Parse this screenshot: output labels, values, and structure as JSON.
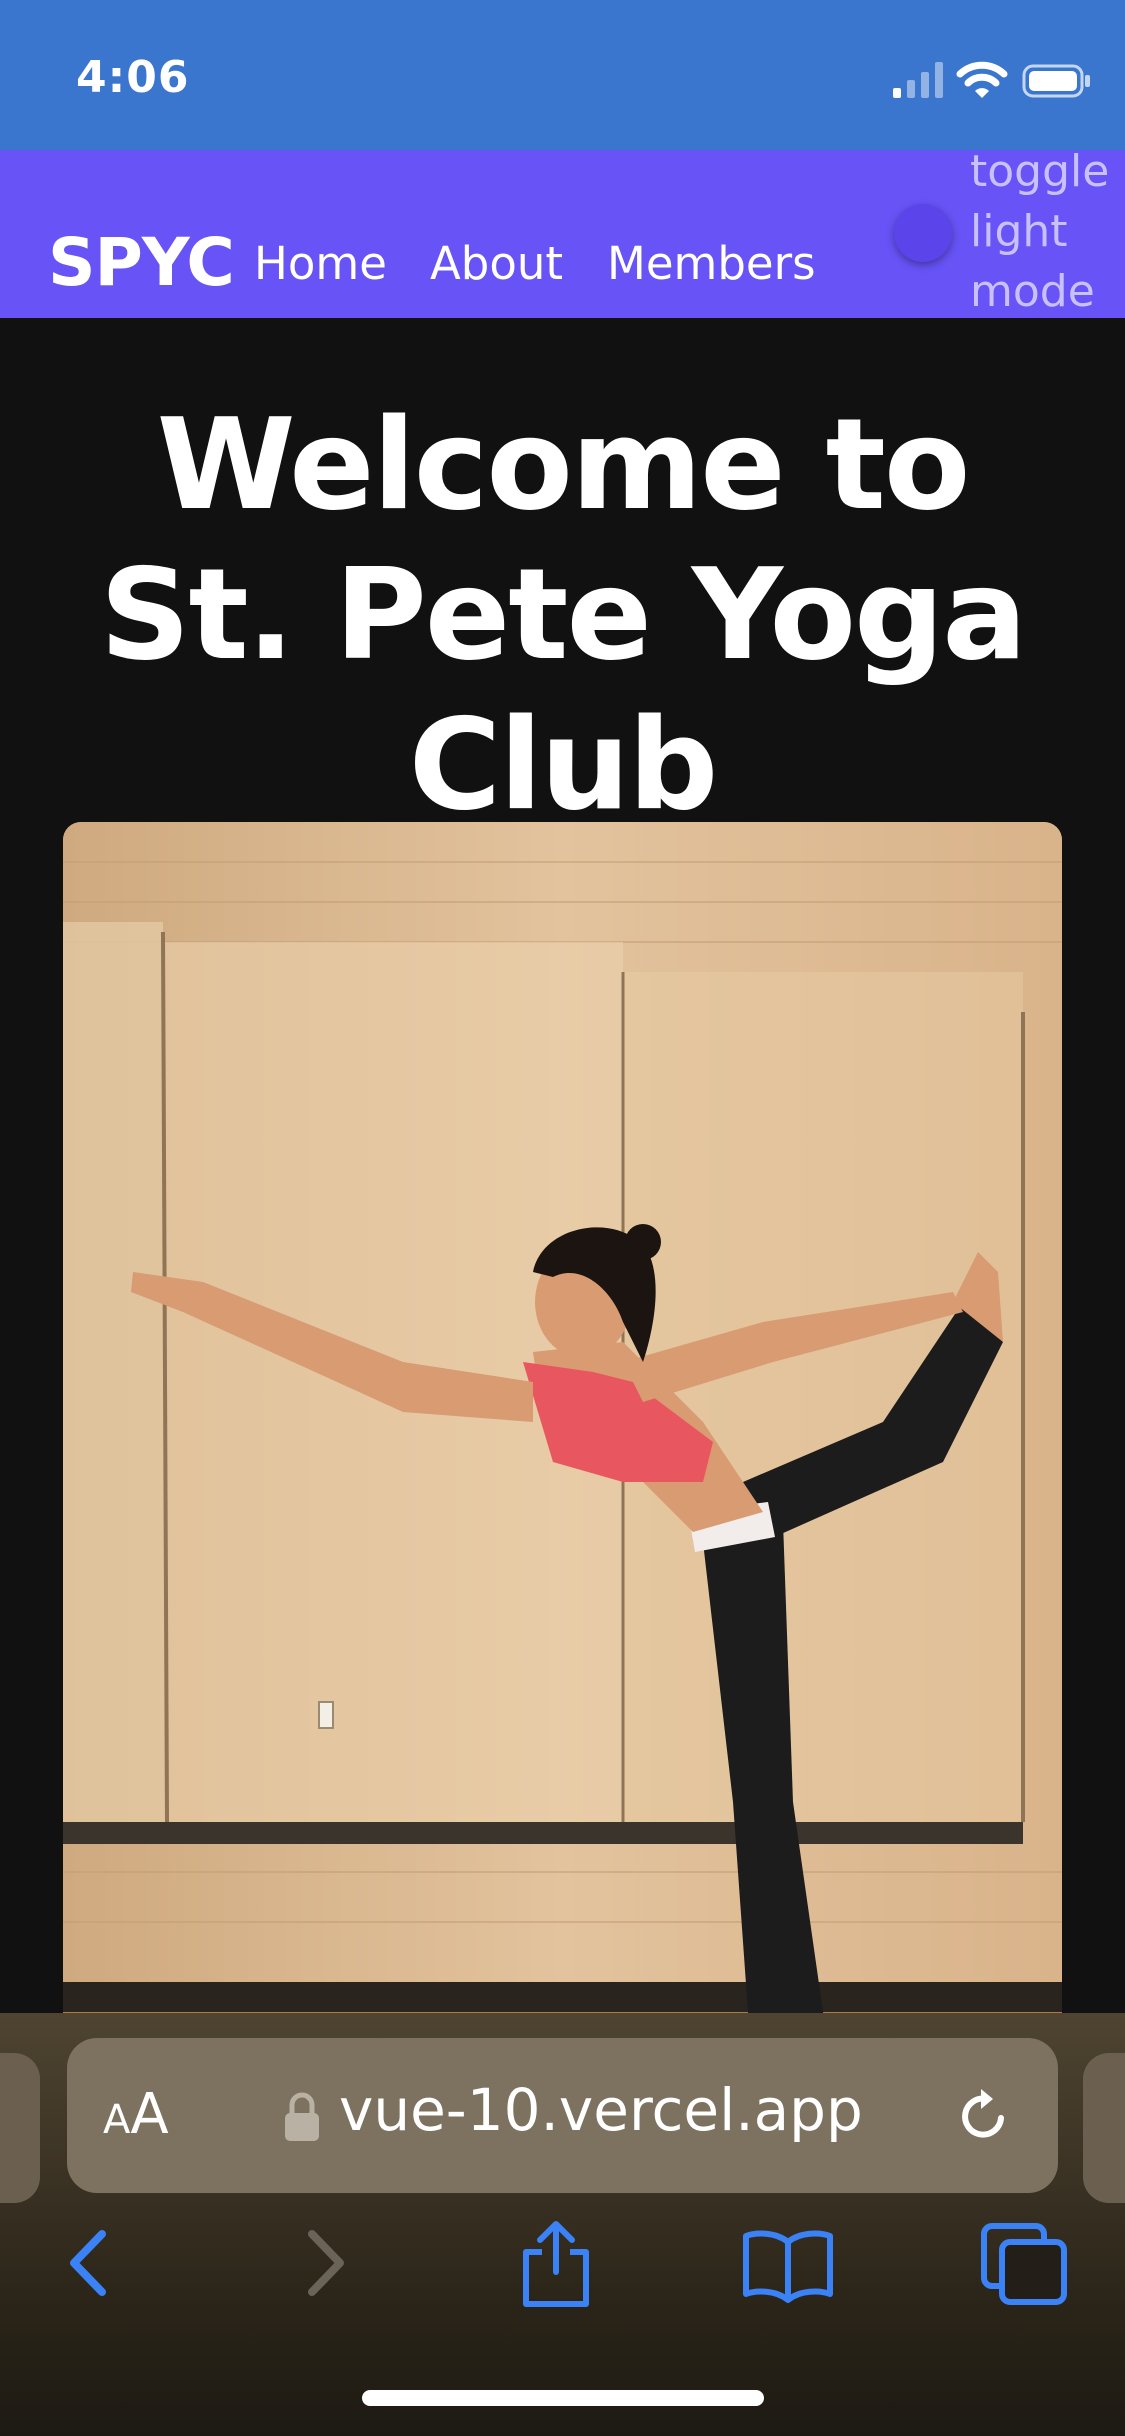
{
  "status_bar": {
    "time": "4:06"
  },
  "nav": {
    "brand": "SPYC",
    "links": [
      "Home",
      "About",
      "Members"
    ],
    "toggle_label": "toggle light mode"
  },
  "main": {
    "title": "Welcome to St. Pete Yoga Club",
    "image_alt": "Woman in dancer yoga pose in studio"
  },
  "browser": {
    "aa_small": "A",
    "aa_large": "A",
    "url": "vue-10.vercel.app"
  },
  "colors": {
    "status_bar_bg": "#3a75ce",
    "nav_bg": "#6753f6",
    "page_bg": "#111111",
    "toolbar_icon": "#3a82f6"
  },
  "icons": {
    "lock": "lock-icon",
    "reload": "reload-icon",
    "back": "chevron-left-icon",
    "forward": "chevron-right-icon",
    "share": "share-icon",
    "bookmarks": "book-icon",
    "tabs": "tabs-icon"
  }
}
